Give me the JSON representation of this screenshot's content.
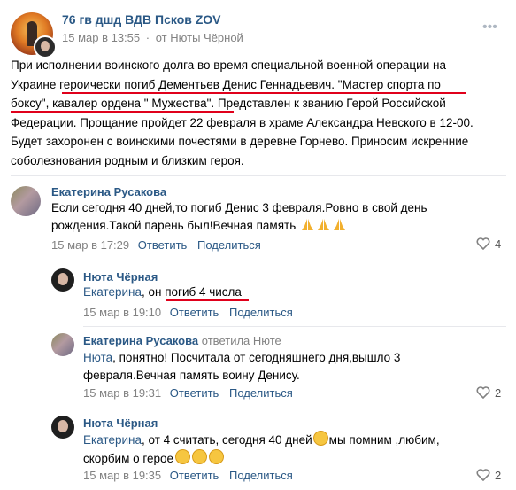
{
  "post": {
    "author": "76 гв дшд ВДВ Псков ZOV",
    "date": "15 мар в 13:55",
    "from_prefix": "от",
    "from_name": "Нюты Чёрной",
    "lines": [
      "При исполнении воинского долга во время специальной военной операции на",
      "Украине героически погиб Дементьев Денис Геннадьевич. \"Мастер спорта по",
      "боксу\", кавалер ордена \" Мужества\". Представлен к званию Герой Российской",
      "Федерации. Прощание пройдет 22 февраля в храме Александра Невского в 12-00.",
      "Будет захоронен с воинскими почестями в деревне Горнево. Приносим искренние",
      "соболезнования родным и близким героя."
    ]
  },
  "comments": [
    {
      "author": "Екатерина Русакова",
      "lines": [
        "Если сегодня 40 дней,то погиб Денис 3 февраля.Ровно в свой день",
        "рождения.Такой парень был!Вечная память"
      ],
      "date": "15 мар в 17:29",
      "reply": "Ответить",
      "like": "Поделиться",
      "likes": "4"
    },
    {
      "author": "Нюта Чёрная",
      "mention": "Екатерина",
      "text": ", он погиб 4 числа",
      "date": "15 мар в 19:10",
      "reply": "Ответить",
      "like": "Поделиться"
    },
    {
      "author": "Екатерина Русакова",
      "reply_to": "ответила Нюте",
      "mention": "Нюта",
      "lines": [
        ", понятно! Посчитала от сегодняшнего дня,вышло 3",
        "февраля.Вечная память воину Денису."
      ],
      "date": "15 мар в 19:31",
      "reply": "Ответить",
      "like": "Поделиться",
      "likes": "2"
    },
    {
      "author": "Нюта Чёрная",
      "mention": "Екатерина",
      "lines": [
        ", от 4 считать, сегодня 40 дней",
        "мы помним ,любим,",
        "скорбим о герое"
      ],
      "date": "15 мар в 19:35",
      "reply": "Ответить",
      "like": "Поделиться",
      "likes": "2"
    }
  ],
  "colors": {
    "link": "#2a5885",
    "meta": "#828282",
    "underline": "#e0001b"
  }
}
